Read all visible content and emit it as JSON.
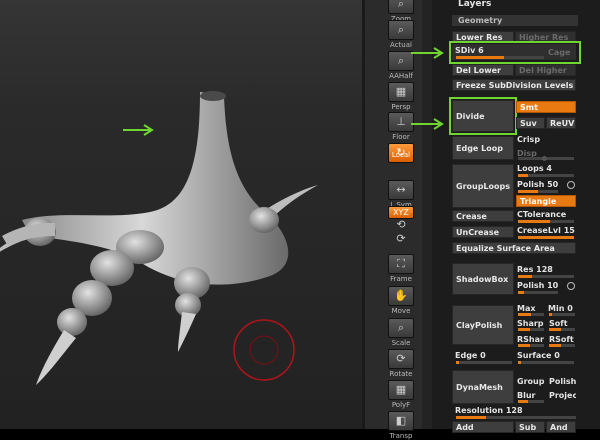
{
  "shelf": {
    "zoom": "Zoom",
    "actual": "Actual",
    "aahalf": "AAHalf",
    "persp": "Persp",
    "floor": "Floor",
    "local": "Local",
    "lsym": "L.Sym",
    "xyz": "XYZ",
    "frame": "Frame",
    "move": "Move",
    "scale": "Scale",
    "rotate": "Rotate",
    "polyf": "PolyF",
    "transp": "Transp"
  },
  "panel": {
    "title": "Layers",
    "geometry": "Geometry",
    "lower_res": "Lower Res",
    "higher_res": "Higher Res",
    "sdiv_label": "SDiv",
    "sdiv_value": "6",
    "sdiv_fraction": 0.55,
    "cage": "Cage",
    "del_lower": "Del Lower",
    "del_higher": "Del Higher",
    "freeze": "Freeze SubDivision Levels",
    "divide": "Divide",
    "smt": "Smt",
    "suv": "Suv",
    "reuv": "ReUV",
    "edge_loop": "Edge Loop",
    "crisp": "Crisp",
    "disp": "Disp",
    "group_loops": "GroupLoops",
    "loops_label": "Loops",
    "loops_value": "4",
    "polish_label": "Polish",
    "polish_value": "50",
    "triangle": "Triangle",
    "crease": "Crease",
    "ctolerance": "CTolerance",
    "uncrease": "UnCrease",
    "creaselvl_label": "CreaseLvl",
    "creaselvl_value": "15",
    "equalize": "Equalize Surface Area",
    "shadowbox": "ShadowBox",
    "res_label": "Res",
    "res_value": "128",
    "sb_polish_label": "Polish",
    "sb_polish_value": "10",
    "claypolish": "ClayPolish",
    "max": "Max",
    "min_label": "Min",
    "min_value": "0",
    "sharp": "Sharp",
    "soft": "Soft",
    "rshar": "RShar",
    "rsoft": "RSoft",
    "edge_label": "Edge",
    "edge_value": "0",
    "surface_label": "Surface",
    "surface_value": "0",
    "dynamesh": "DynaMesh",
    "group": "Group",
    "polish": "Polish",
    "blur": "Blur",
    "project": "Project",
    "resolution_label": "Resolution",
    "resolution_value": "128",
    "add": "Add",
    "sub": "Sub",
    "and": "And"
  },
  "colors": {
    "accent": "#e97a12",
    "highlight": "#6fd62f",
    "brush_ring": "#b0141a"
  }
}
